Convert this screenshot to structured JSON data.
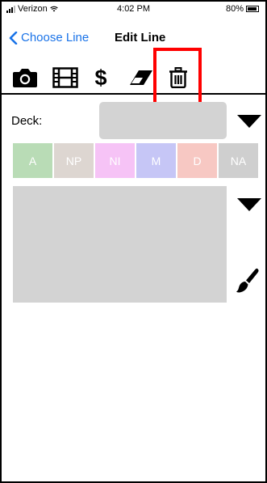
{
  "status_bar": {
    "carrier": "Verizon",
    "time": "4:02 PM",
    "battery": "80%",
    "battery_level": 0.8
  },
  "nav": {
    "back_label": "Choose Line",
    "title": "Edit Line"
  },
  "toolbar": {
    "items": [
      {
        "icon": "camera-icon"
      },
      {
        "icon": "film-icon"
      },
      {
        "icon": "dollar-icon",
        "glyph": "$"
      },
      {
        "icon": "eraser-icon"
      },
      {
        "icon": "trash-icon",
        "highlighted": true
      }
    ]
  },
  "deck": {
    "label": "Deck:",
    "value": ""
  },
  "categories": [
    {
      "label": "A",
      "color": "#b9dcb6"
    },
    {
      "label": "NP",
      "color": "#ddd6d1"
    },
    {
      "label": "NI",
      "color": "#f6c3f6"
    },
    {
      "label": "M",
      "color": "#c6c6f6"
    },
    {
      "label": "D",
      "color": "#f7c8c3"
    },
    {
      "label": "NA",
      "color": "#cfcfcf"
    }
  ],
  "notes": {
    "value": ""
  },
  "colors": {
    "accent": "#1a73e8",
    "field_gray": "#d3d3d3",
    "highlight": "#ff0000"
  }
}
